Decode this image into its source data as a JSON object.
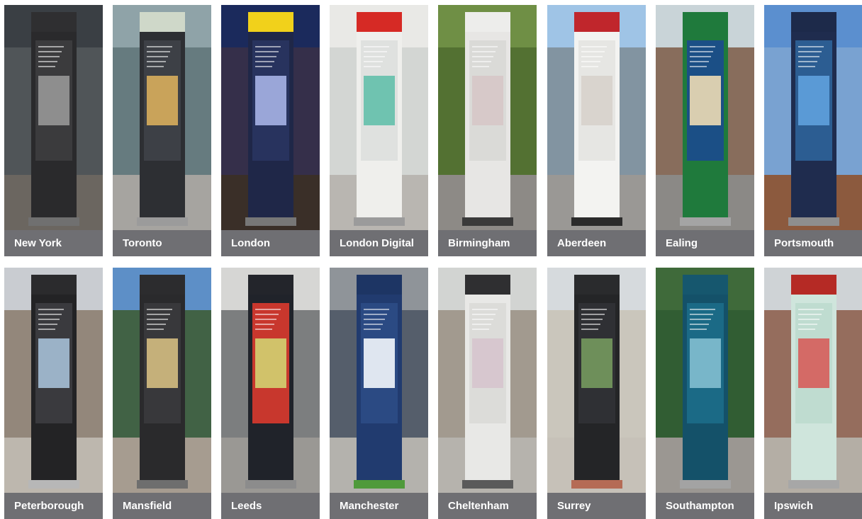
{
  "tiles": [
    {
      "label": "New York",
      "scene": {
        "sky": "#3a3f44",
        "ground": "#6b6660",
        "bg": "#55595c",
        "head": "#2f2f31",
        "body": "#2a2a2c",
        "panel": "#3b3b3d",
        "map": "#8e8e8e",
        "base": "#707070"
      }
    },
    {
      "label": "Toronto",
      "scene": {
        "sky": "#8fa3a8",
        "ground": "#a6a4a0",
        "bg": "#5f7478",
        "head": "#cfd8c9",
        "body": "#2d2f33",
        "panel": "#3d4046",
        "map": "#c9a35a",
        "base": "#9b9b9b"
      }
    },
    {
      "label": "London",
      "scene": {
        "sky": "#1b2a5c",
        "ground": "#3a2f28",
        "bg": "#3a3047",
        "head": "#f1d11b",
        "body": "#1f2748",
        "panel": "#28335e",
        "map": "#9aa6d8",
        "base": "#777777"
      }
    },
    {
      "label": "London Digital",
      "scene": {
        "sky": "#e9e9e6",
        "ground": "#b9b6b1",
        "bg": "#cfd2cf",
        "head": "#d62a25",
        "body": "#efefec",
        "panel": "#dfe1df",
        "map": "#6fc3b0",
        "base": "#9b9b9b"
      }
    },
    {
      "label": "Birmingham",
      "scene": {
        "sky": "#6f8f45",
        "ground": "#8d8a86",
        "bg": "#4f6c2f",
        "head": "#ededeb",
        "body": "#e7e6e4",
        "panel": "#dadad7",
        "map": "#d7c9c9",
        "base": "#3a3a3a"
      }
    },
    {
      "label": "Aberdeen",
      "scene": {
        "sky": "#9fc4e6",
        "ground": "#9a9895",
        "bg": "#7d8c94",
        "head": "#c0262c",
        "body": "#f3f3f1",
        "panel": "#e6e6e3",
        "map": "#d9d4ce",
        "base": "#2b2b2b"
      }
    },
    {
      "label": "Ealing",
      "scene": {
        "sky": "#c9d4d8",
        "ground": "#8b8986",
        "bg": "#7d5a46",
        "head": "#1f7a3c",
        "body": "#1f7a3c",
        "panel": "#1b4f86",
        "map": "#d9ceb0",
        "base": "#a4a4a4"
      }
    },
    {
      "label": "Portsmouth",
      "scene": {
        "sky": "#5b8fcf",
        "ground": "#8c5a3e",
        "bg": "#7fa6d1",
        "head": "#1d2a4a",
        "body": "#1f2c4e",
        "panel": "#2c5d92",
        "map": "#5a9ad6",
        "base": "#8e8e8e"
      }
    },
    {
      "label": "Peterborough",
      "scene": {
        "sky": "#c9ccd1",
        "ground": "#bdb7ae",
        "bg": "#8a7a6c",
        "head": "#2b2b2d",
        "body": "#232325",
        "panel": "#3a3a3e",
        "map": "#9bb2c7",
        "base": "#b7b7b7"
      }
    },
    {
      "label": "Mansfield",
      "scene": {
        "sky": "#5d8fc7",
        "ground": "#a69c90",
        "bg": "#3c5b2e",
        "head": "#2c2c2e",
        "body": "#2a2a2c",
        "panel": "#38383b",
        "map": "#c5b07a",
        "base": "#6e6e6e"
      }
    },
    {
      "label": "Leeds",
      "scene": {
        "sky": "#d6d6d4",
        "ground": "#9a9894",
        "bg": "#6c6e70",
        "head": "#23252b",
        "body": "#20232a",
        "panel": "#c8372d",
        "map": "#d1c26a",
        "base": "#8c8c8c"
      }
    },
    {
      "label": "Manchester",
      "scene": {
        "sky": "#8f9499",
        "ground": "#b4b2ad",
        "bg": "#4b5563",
        "head": "#1d3564",
        "body": "#213b6f",
        "panel": "#2b4a83",
        "map": "#dfe6f0",
        "base": "#4f9a3b"
      }
    },
    {
      "label": "Cheltenham",
      "scene": {
        "sky": "#d2d4d2",
        "ground": "#b6b3ad",
        "bg": "#9a8f84",
        "head": "#2f2f31",
        "body": "#e8e8e6",
        "panel": "#dcdcd9",
        "map": "#d7c7cf",
        "base": "#5a5a5a"
      }
    },
    {
      "label": "Surrey",
      "scene": {
        "sky": "#d6dadd",
        "ground": "#c6c1b8",
        "bg": "#c8c2b6",
        "head": "#2a2b2d",
        "body": "#242527",
        "panel": "#2f3034",
        "map": "#6e8f5a",
        "base": "#b56b55"
      }
    },
    {
      "label": "Southampton",
      "scene": {
        "sky": "#3f6a3a",
        "ground": "#9b9792",
        "bg": "#2f5a32",
        "head": "#16576e",
        "body": "#145169",
        "panel": "#1b6a86",
        "map": "#78b6c9",
        "base": "#a3a3a3"
      }
    },
    {
      "label": "Ipswich",
      "scene": {
        "sky": "#cfd3d6",
        "ground": "#b4aea5",
        "bg": "#8b5a48",
        "head": "#b52a25",
        "body": "#cfe5dc",
        "panel": "#bfdcd0",
        "map": "#d46a66",
        "base": "#a7a7a7"
      }
    }
  ]
}
